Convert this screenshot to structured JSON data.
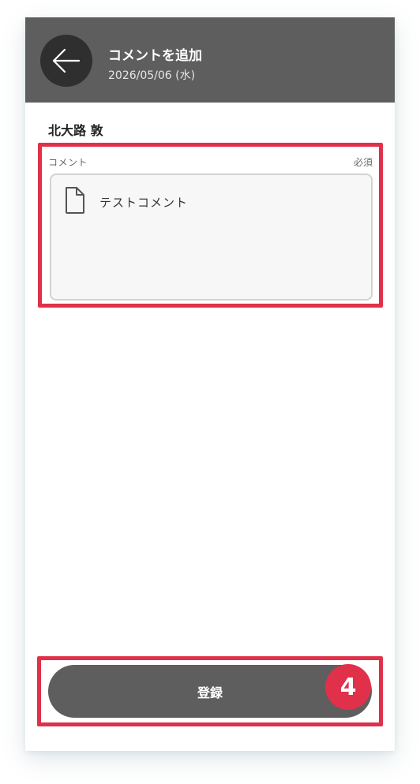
{
  "header": {
    "title": "コメントを追加",
    "date": "2026/05/06 (水)",
    "back_icon": "arrow-left-icon"
  },
  "user": {
    "name": "北大路 敦"
  },
  "comment_field": {
    "label": "コメント",
    "required": "必須",
    "value": "テストコメント",
    "icon": "document-icon"
  },
  "submit": {
    "label": "登録",
    "step_badge": "4"
  },
  "colors": {
    "header_bg": "#5e5e5e",
    "back_button_bg": "#2f2f2f",
    "highlight": "#e0304a",
    "button_bg": "#5e5e5e"
  }
}
